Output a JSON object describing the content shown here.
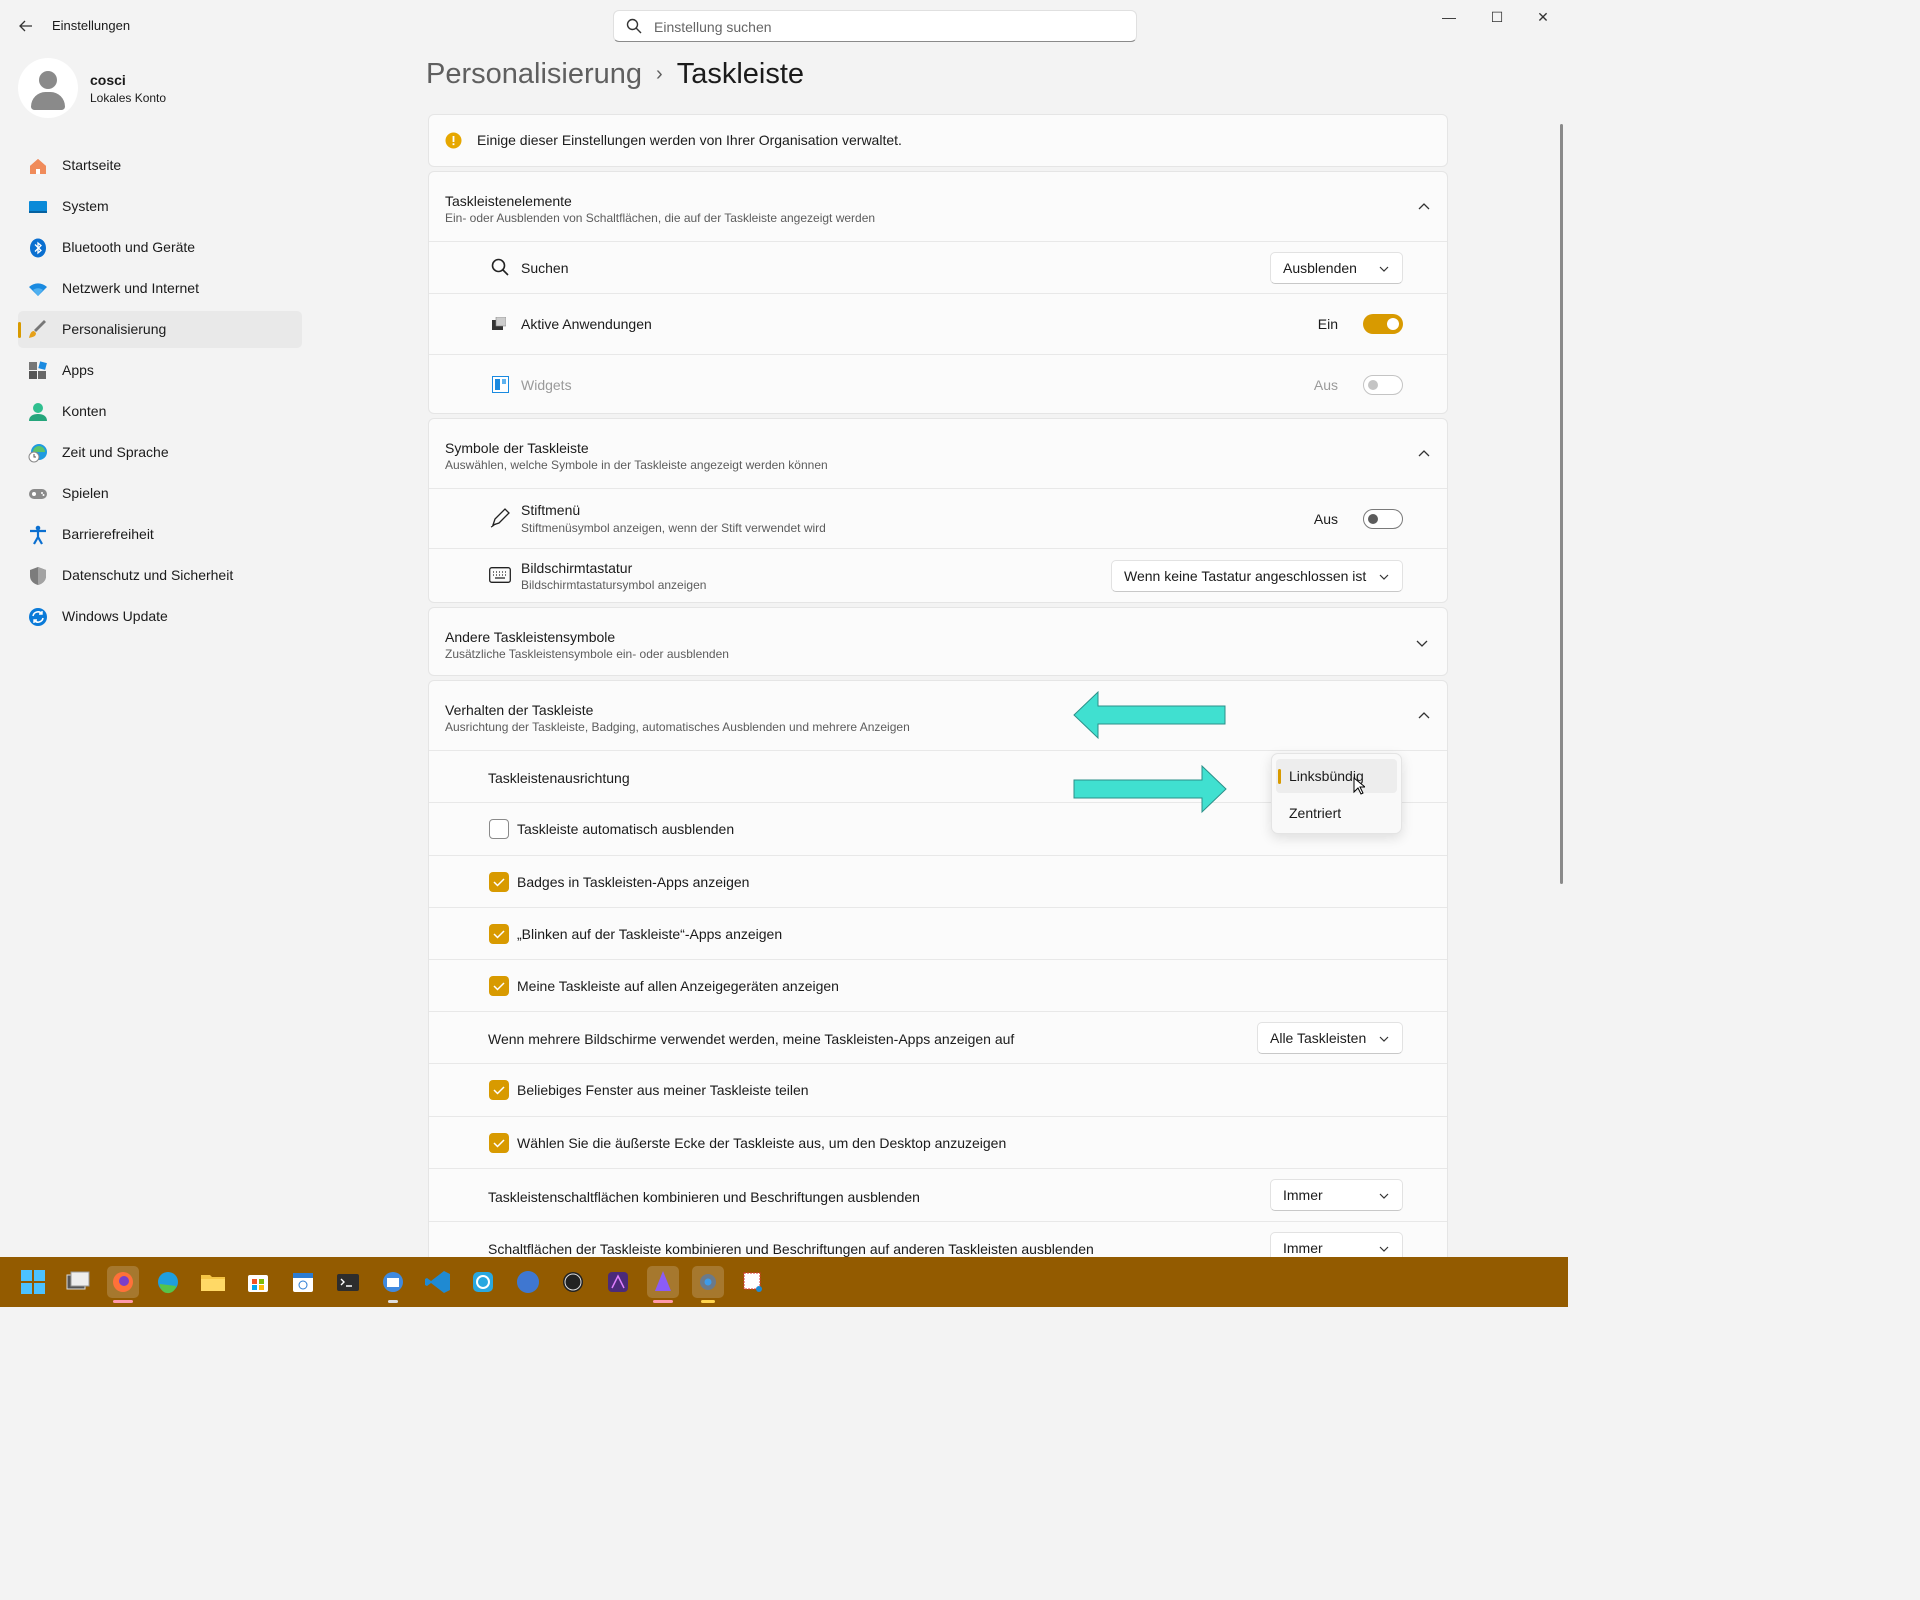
{
  "window": {
    "title": "Einstellungen",
    "minimize": "—",
    "maximize": "☐",
    "close": "✕"
  },
  "search": {
    "placeholder": "Einstellung suchen"
  },
  "profile": {
    "name": "cosci",
    "account_type": "Lokales Konto"
  },
  "nav": {
    "items": [
      {
        "label": "Startseite",
        "icon": "home-icon"
      },
      {
        "label": "System",
        "icon": "system-icon"
      },
      {
        "label": "Bluetooth und Geräte",
        "icon": "bluetooth-icon"
      },
      {
        "label": "Netzwerk und Internet",
        "icon": "wifi-icon"
      },
      {
        "label": "Personalisierung",
        "icon": "brush-icon",
        "active": true
      },
      {
        "label": "Apps",
        "icon": "apps-icon"
      },
      {
        "label": "Konten",
        "icon": "account-icon"
      },
      {
        "label": "Zeit und Sprache",
        "icon": "clock-globe-icon"
      },
      {
        "label": "Spielen",
        "icon": "gamepad-icon"
      },
      {
        "label": "Barrierefreiheit",
        "icon": "accessibility-icon"
      },
      {
        "label": "Datenschutz und Sicherheit",
        "icon": "shield-icon"
      },
      {
        "label": "Windows Update",
        "icon": "update-icon"
      }
    ]
  },
  "breadcrumb": {
    "parent": "Personalisierung",
    "current": "Taskleiste",
    "separator": "›"
  },
  "notice": {
    "text": "Einige dieser Einstellungen werden von Ihrer Organisation verwaltet."
  },
  "taskbar_items": {
    "title": "Taskleistenelemente",
    "subtitle": "Ein- oder Ausblenden von Schaltflächen, die auf der Taskleiste angezeigt werden",
    "search": {
      "label": "Suchen",
      "value": "Ausblenden"
    },
    "active_apps": {
      "label": "Aktive Anwendungen",
      "state": "Ein"
    },
    "widgets": {
      "label": "Widgets",
      "state": "Aus"
    }
  },
  "taskbar_icons": {
    "title": "Symbole der Taskleiste",
    "subtitle": "Auswählen, welche Symbole in der Taskleiste angezeigt werden können",
    "pen": {
      "label": "Stiftmenü",
      "sub": "Stiftmenüsymbol anzeigen, wenn der Stift verwendet wird",
      "state": "Aus"
    },
    "keyboard": {
      "label": "Bildschirmtastatur",
      "sub": "Bildschirmtastatursymbol anzeigen",
      "value": "Wenn keine Tastatur angeschlossen ist"
    }
  },
  "other_icons": {
    "title": "Andere Taskleistensymbole",
    "subtitle": "Zusätzliche Taskleistensymbole ein- oder ausblenden"
  },
  "behavior": {
    "title": "Verhalten der Taskleiste",
    "subtitle": "Ausrichtung der Taskleiste, Badging, automatisches Ausblenden und mehrere Anzeigen",
    "alignment": {
      "label": "Taskleistenausrichtung",
      "options": [
        "Linksbündig",
        "Zentriert"
      ],
      "selected": "Linksbündig"
    },
    "autohide": {
      "label": "Taskleiste automatisch ausblenden",
      "checked": false
    },
    "badges": {
      "label": "Badges in Taskleisten-Apps anzeigen",
      "checked": true
    },
    "flashing": {
      "label": "„Blinken auf der Taskleiste“-Apps anzeigen",
      "checked": true
    },
    "all_displays": {
      "label": "Meine Taskleiste auf allen Anzeigegeräten anzeigen",
      "checked": true
    },
    "multi_monitor": {
      "label": "Wenn mehrere Bildschirme verwendet werden, meine Taskleisten-Apps anzeigen auf",
      "value": "Alle Taskleisten"
    },
    "share_window": {
      "label": "Beliebiges Fenster aus meiner Taskleiste teilen",
      "checked": true
    },
    "far_corner": {
      "label": "Wählen Sie die äußerste Ecke der Taskleiste aus, um den Desktop anzuzeigen",
      "checked": true
    },
    "combine": {
      "label": "Taskleistenschaltflächen kombinieren und Beschriftungen ausblenden",
      "value": "Immer"
    },
    "combine_other": {
      "label": "Schaltflächen der Taskleiste kombinieren und Beschriftungen auf anderen Taskleisten ausblenden",
      "value": "Immer"
    }
  },
  "colors": {
    "accent": "#d89a00",
    "taskbar": "#935b00",
    "annotation_arrow": "#40e0d0"
  },
  "windows_taskbar": {
    "icons": [
      "start-icon",
      "task-view-icon",
      "firefox-icon",
      "edge-icon",
      "file-explorer-icon",
      "store-icon",
      "calendar-icon",
      "terminal-icon",
      "thunderbird-icon",
      "vscode-icon",
      "sync-icon",
      "canva-icon",
      "obs-icon",
      "affinity-photo-icon",
      "affinity-designer-icon",
      "settings-icon",
      "snipping-tool-icon"
    ]
  }
}
